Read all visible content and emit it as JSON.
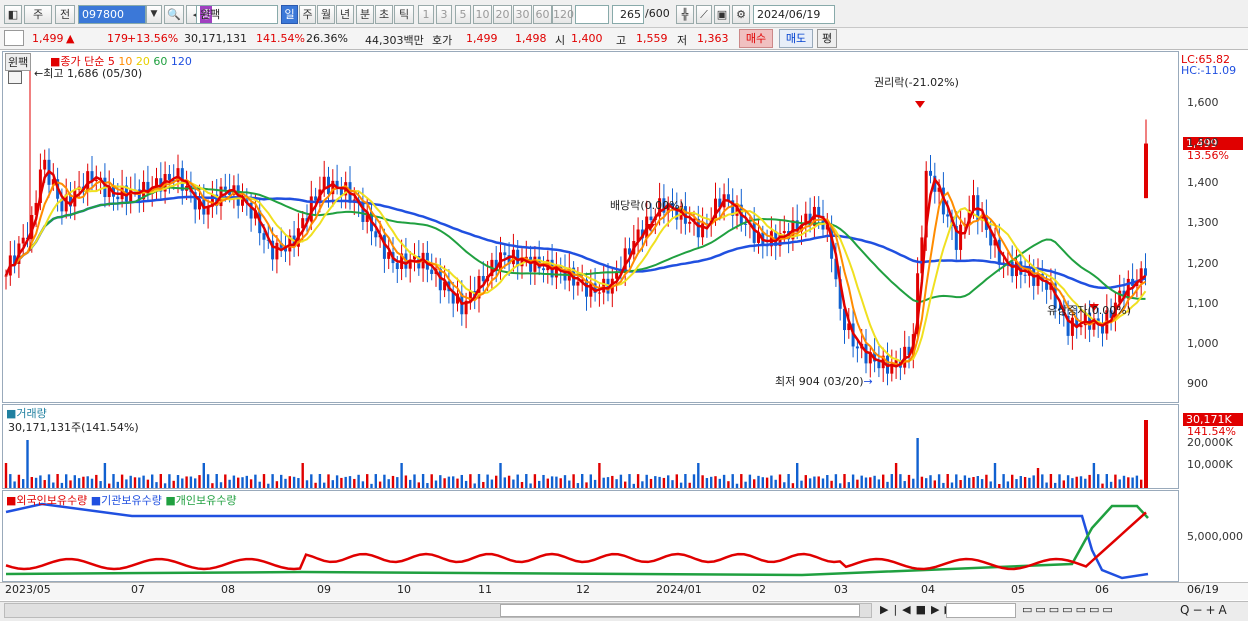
{
  "toolbar": {
    "code": "097800",
    "stock_name": "윈팩",
    "period_tabs": [
      "일",
      "주",
      "월",
      "년",
      "분",
      "초",
      "틱"
    ],
    "minute_options": [
      "1",
      "3",
      "5",
      "10",
      "20",
      "30",
      "60",
      "120"
    ],
    "count": "265",
    "count_total": "/600",
    "date": "2024/06/19",
    "prev_btn": "주",
    "next_btn": "전"
  },
  "quote": {
    "price": "1,499",
    "change_arrow": "▲",
    "change": "179",
    "change_pct": "+13.56%",
    "volume": "30,171,131",
    "volume_ratio": "141.54%",
    "turnover": "26.36%",
    "amount": "44,303백만",
    "hoga_label": "호가",
    "ask": "1,499",
    "bid": "1,498",
    "open_label": "시",
    "open": "1,400",
    "high_label": "고",
    "high": "1,559",
    "low_label": "저",
    "low": "1,363",
    "buy_btn": "매수",
    "sell_btn": "매도",
    "extra_btn": "평"
  },
  "price_panel": {
    "stock_tag": "윈팩",
    "legend": {
      "title": "종가 단순",
      "ma": [
        "5",
        "10",
        "20",
        "60",
        "120"
      ]
    },
    "high_note": "최고 1,686 (05/30)",
    "low_note": "최저 904 (03/20)",
    "events": [
      "권리락(-21.02%)",
      "배당락(0.00%)",
      "유상증자(0.00%)"
    ],
    "lc": "LC:65.82",
    "hc": "HC:-11.09",
    "last_price": "1,499",
    "last_pct": "13.56%",
    "y_ticks": [
      "1,600",
      "1,500",
      "1,400",
      "1,300",
      "1,200",
      "1,100",
      "1,000",
      "900"
    ]
  },
  "volume_panel": {
    "title": "거래량",
    "value": "30,171,131주(141.54%)",
    "last": "30,171K",
    "last_pct": "141.54%",
    "y_ticks": [
      "20,000K",
      "10,000K"
    ]
  },
  "holder_panel": {
    "legend": [
      "외국인보유수량",
      "기관보유수량",
      "개인보유수량"
    ],
    "y_tick": "5,000,000"
  },
  "x_axis": [
    "2023/05",
    "07",
    "08",
    "09",
    "10",
    "11",
    "12",
    "2024/01",
    "02",
    "03",
    "04",
    "05",
    "06",
    "06/19"
  ],
  "colors": {
    "ma5": "#e00000",
    "ma10": "#ff8c00",
    "ma20": "#f0e020",
    "ma60": "#20a040",
    "ma120": "#2050e0",
    "up": "#e00000",
    "down": "#1060d0"
  }
}
